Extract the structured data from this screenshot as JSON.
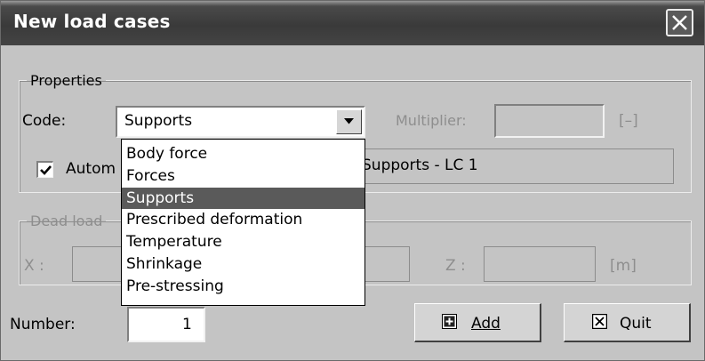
{
  "window": {
    "title": "New load cases"
  },
  "properties": {
    "legend": "Properties",
    "code_label": "Code:",
    "code_value": "Supports",
    "multiplier_label": "Multiplier:",
    "multiplier_unit": "[–]",
    "automatic_label": "Autom",
    "name_value": "Supports - LC 1",
    "automatic_checked": true
  },
  "code_options": [
    "Body force",
    "Forces",
    "Supports",
    "Prescribed deformation",
    "Temperature",
    "Shrinkage",
    "Pre-stressing"
  ],
  "dead_load": {
    "legend": "Dead load",
    "x_label": "X :",
    "z_label": "Z :",
    "unit": "[m]"
  },
  "footer": {
    "number_label": "Number:",
    "number_value": "1",
    "add_label": "Add",
    "quit_label": "Quit"
  },
  "colors": {
    "title_bar": "#3a3a3a",
    "dialog_bg": "#c4c4c4",
    "selection": "#5a5a5a"
  },
  "icons": {
    "close": "close-icon",
    "dropdown": "chevron-down-icon",
    "add": "plus-box-icon",
    "quit": "x-box-icon"
  }
}
